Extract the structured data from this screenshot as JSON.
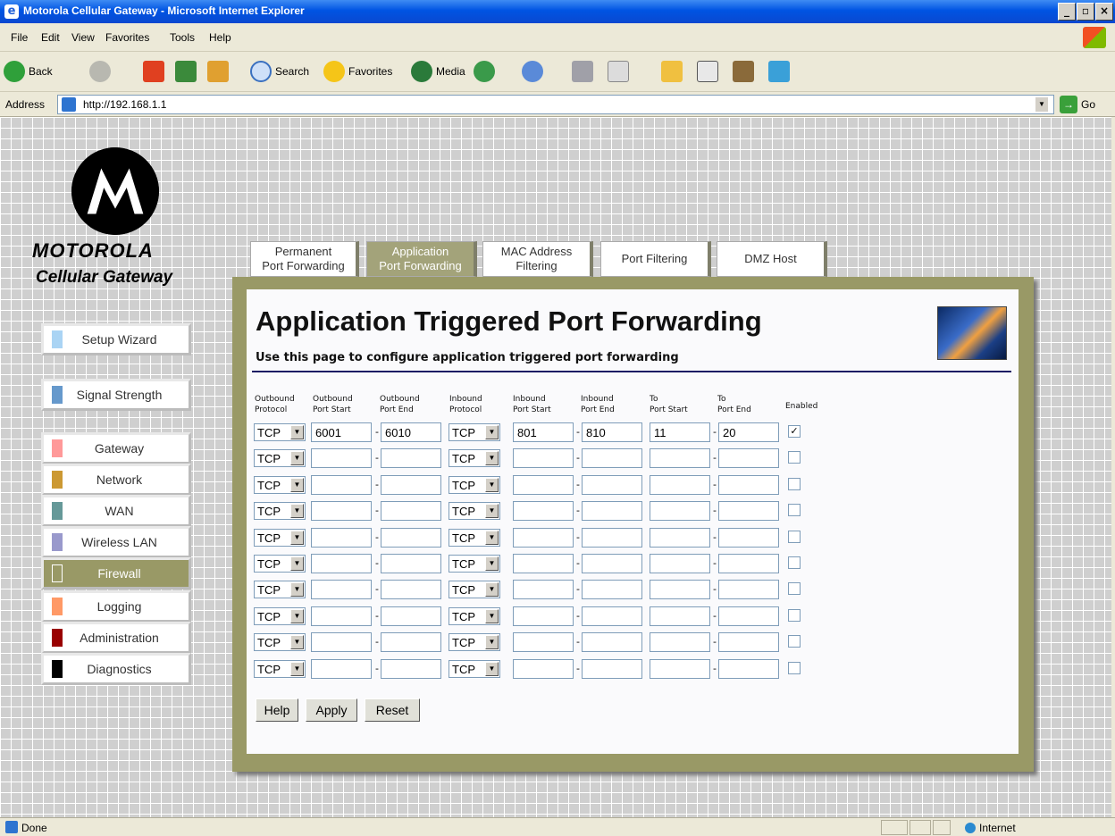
{
  "window": {
    "title": "Motorola Cellular Gateway - Microsoft Internet Explorer",
    "min": "_",
    "max": "▫",
    "close": "×"
  },
  "menu": [
    "File",
    "Edit",
    "View",
    "Favorites",
    "Tools",
    "Help"
  ],
  "toolbar": {
    "back": "Back",
    "search": "Search",
    "favorites": "Favorites",
    "media": "Media"
  },
  "address": {
    "label": "Address",
    "url": "http://192.168.1.1",
    "go": "Go"
  },
  "brand": {
    "name": "MOTOROLA",
    "product": "Cellular Gateway"
  },
  "nav": [
    {
      "label": "Setup Wizard",
      "color": "#aad4f4"
    },
    {
      "label": "Signal Strength",
      "color": "#6699cc"
    },
    {
      "label": "Gateway",
      "color": "#ff9999"
    },
    {
      "label": "Network",
      "color": "#cc9933"
    },
    {
      "label": "WAN",
      "color": "#669999"
    },
    {
      "label": "Wireless LAN",
      "color": "#9999cc"
    },
    {
      "label": "Firewall",
      "color": "#999966"
    },
    {
      "label": "Logging",
      "color": "#ff9966"
    },
    {
      "label": "Administration",
      "color": "#990000"
    },
    {
      "label": "Diagnostics",
      "color": "#000000"
    }
  ],
  "active_nav": "Firewall",
  "tabs": [
    {
      "line1": "Permanent",
      "line2": "Port Forwarding"
    },
    {
      "line1": "Application",
      "line2": "Port Forwarding"
    },
    {
      "line1": "MAC Address",
      "line2": "Filtering"
    },
    {
      "line1": "Port Filtering",
      "line2": ""
    },
    {
      "line1": "DMZ Host",
      "line2": ""
    }
  ],
  "active_tab": "Application Port Forwarding",
  "page": {
    "heading": "Application Triggered Port Forwarding",
    "subheading": "Use this page to configure application triggered port forwarding"
  },
  "columns": [
    {
      "l1": "Outbound",
      "l2": "Protocol"
    },
    {
      "l1": "Outbound",
      "l2": "Port Start"
    },
    {
      "l1": "Outbound",
      "l2": "Port End"
    },
    {
      "l1": "Inbound",
      "l2": "Protocol"
    },
    {
      "l1": "Inbound",
      "l2": "Port Start"
    },
    {
      "l1": "Inbound",
      "l2": "Port End"
    },
    {
      "l1": "To",
      "l2": "Port Start"
    },
    {
      "l1": "To",
      "l2": "Port End"
    },
    {
      "l1": "Enabled",
      "l2": ""
    }
  ],
  "rows": [
    {
      "out_proto": "TCP",
      "out_start": "6001",
      "out_end": "6010",
      "in_proto": "TCP",
      "in_start": "801",
      "in_end": "810",
      "to_start": "11",
      "to_end": "20",
      "enabled": true
    },
    {
      "out_proto": "TCP",
      "out_start": "",
      "out_end": "",
      "in_proto": "TCP",
      "in_start": "",
      "in_end": "",
      "to_start": "",
      "to_end": "",
      "enabled": false
    },
    {
      "out_proto": "TCP",
      "out_start": "",
      "out_end": "",
      "in_proto": "TCP",
      "in_start": "",
      "in_end": "",
      "to_start": "",
      "to_end": "",
      "enabled": false
    },
    {
      "out_proto": "TCP",
      "out_start": "",
      "out_end": "",
      "in_proto": "TCP",
      "in_start": "",
      "in_end": "",
      "to_start": "",
      "to_end": "",
      "enabled": false
    },
    {
      "out_proto": "TCP",
      "out_start": "",
      "out_end": "",
      "in_proto": "TCP",
      "in_start": "",
      "in_end": "",
      "to_start": "",
      "to_end": "",
      "enabled": false
    },
    {
      "out_proto": "TCP",
      "out_start": "",
      "out_end": "",
      "in_proto": "TCP",
      "in_start": "",
      "in_end": "",
      "to_start": "",
      "to_end": "",
      "enabled": false
    },
    {
      "out_proto": "TCP",
      "out_start": "",
      "out_end": "",
      "in_proto": "TCP",
      "in_start": "",
      "in_end": "",
      "to_start": "",
      "to_end": "",
      "enabled": false
    },
    {
      "out_proto": "TCP",
      "out_start": "",
      "out_end": "",
      "in_proto": "TCP",
      "in_start": "",
      "in_end": "",
      "to_start": "",
      "to_end": "",
      "enabled": false
    },
    {
      "out_proto": "TCP",
      "out_start": "",
      "out_end": "",
      "in_proto": "TCP",
      "in_start": "",
      "in_end": "",
      "to_start": "",
      "to_end": "",
      "enabled": false
    },
    {
      "out_proto": "TCP",
      "out_start": "",
      "out_end": "",
      "in_proto": "TCP",
      "in_start": "",
      "in_end": "",
      "to_start": "",
      "to_end": "",
      "enabled": false
    }
  ],
  "buttons": {
    "help": "Help",
    "apply": "Apply",
    "reset": "Reset"
  },
  "status": {
    "text": "Done",
    "zone": "Internet"
  },
  "colors": {
    "panel": "#999966",
    "rule": "#1c1c64",
    "grid_bg": "#cfcfcf"
  }
}
